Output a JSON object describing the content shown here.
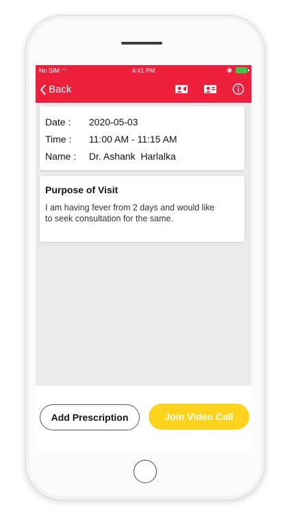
{
  "status_bar": {
    "carrier": "No SIM",
    "time": "4:41 PM"
  },
  "nav": {
    "back_label": "Back"
  },
  "appointment": {
    "date_label": "Date :",
    "date": "2020-05-03",
    "time_label": "Time :",
    "time": "11:00 AM - 11:15 AM",
    "name_label": "Name :",
    "name": "Dr. Ashank  Harlalka"
  },
  "purpose": {
    "title": "Purpose of Visit",
    "text": "I am having fever from 2 days and would like to seek consultation for the same."
  },
  "actions": {
    "add_prescription": "Add Prescription",
    "join_video_call": "Join Video Call"
  },
  "colors": {
    "header": "#ee1f3b",
    "video_button": "#ffd21b",
    "background": "#ebebeb"
  }
}
